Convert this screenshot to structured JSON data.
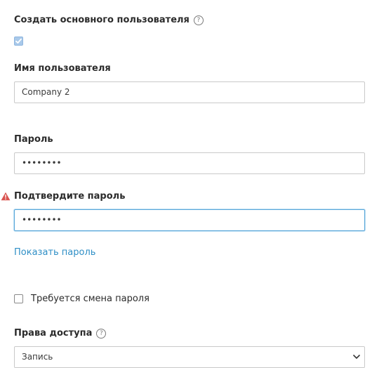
{
  "create_user": {
    "label": "Создать основного пользователя",
    "checked": true
  },
  "username": {
    "label": "Имя пользователя",
    "value": "Company 2"
  },
  "password": {
    "label": "Пароль",
    "value": "••••••••"
  },
  "confirm_password": {
    "label": "Подтвердите пароль",
    "value": "••••••••",
    "warning_icon": "warning-triangle-icon"
  },
  "show_password_link": "Показать пароль",
  "require_password_change": {
    "label": "Требуется смена пароля",
    "checked": false
  },
  "access_rights": {
    "label": "Права доступа",
    "selected": "Запись"
  },
  "colors": {
    "accent": "#2f8fc6",
    "focus_border": "#5aa7d9",
    "warning": "#d9534f"
  }
}
